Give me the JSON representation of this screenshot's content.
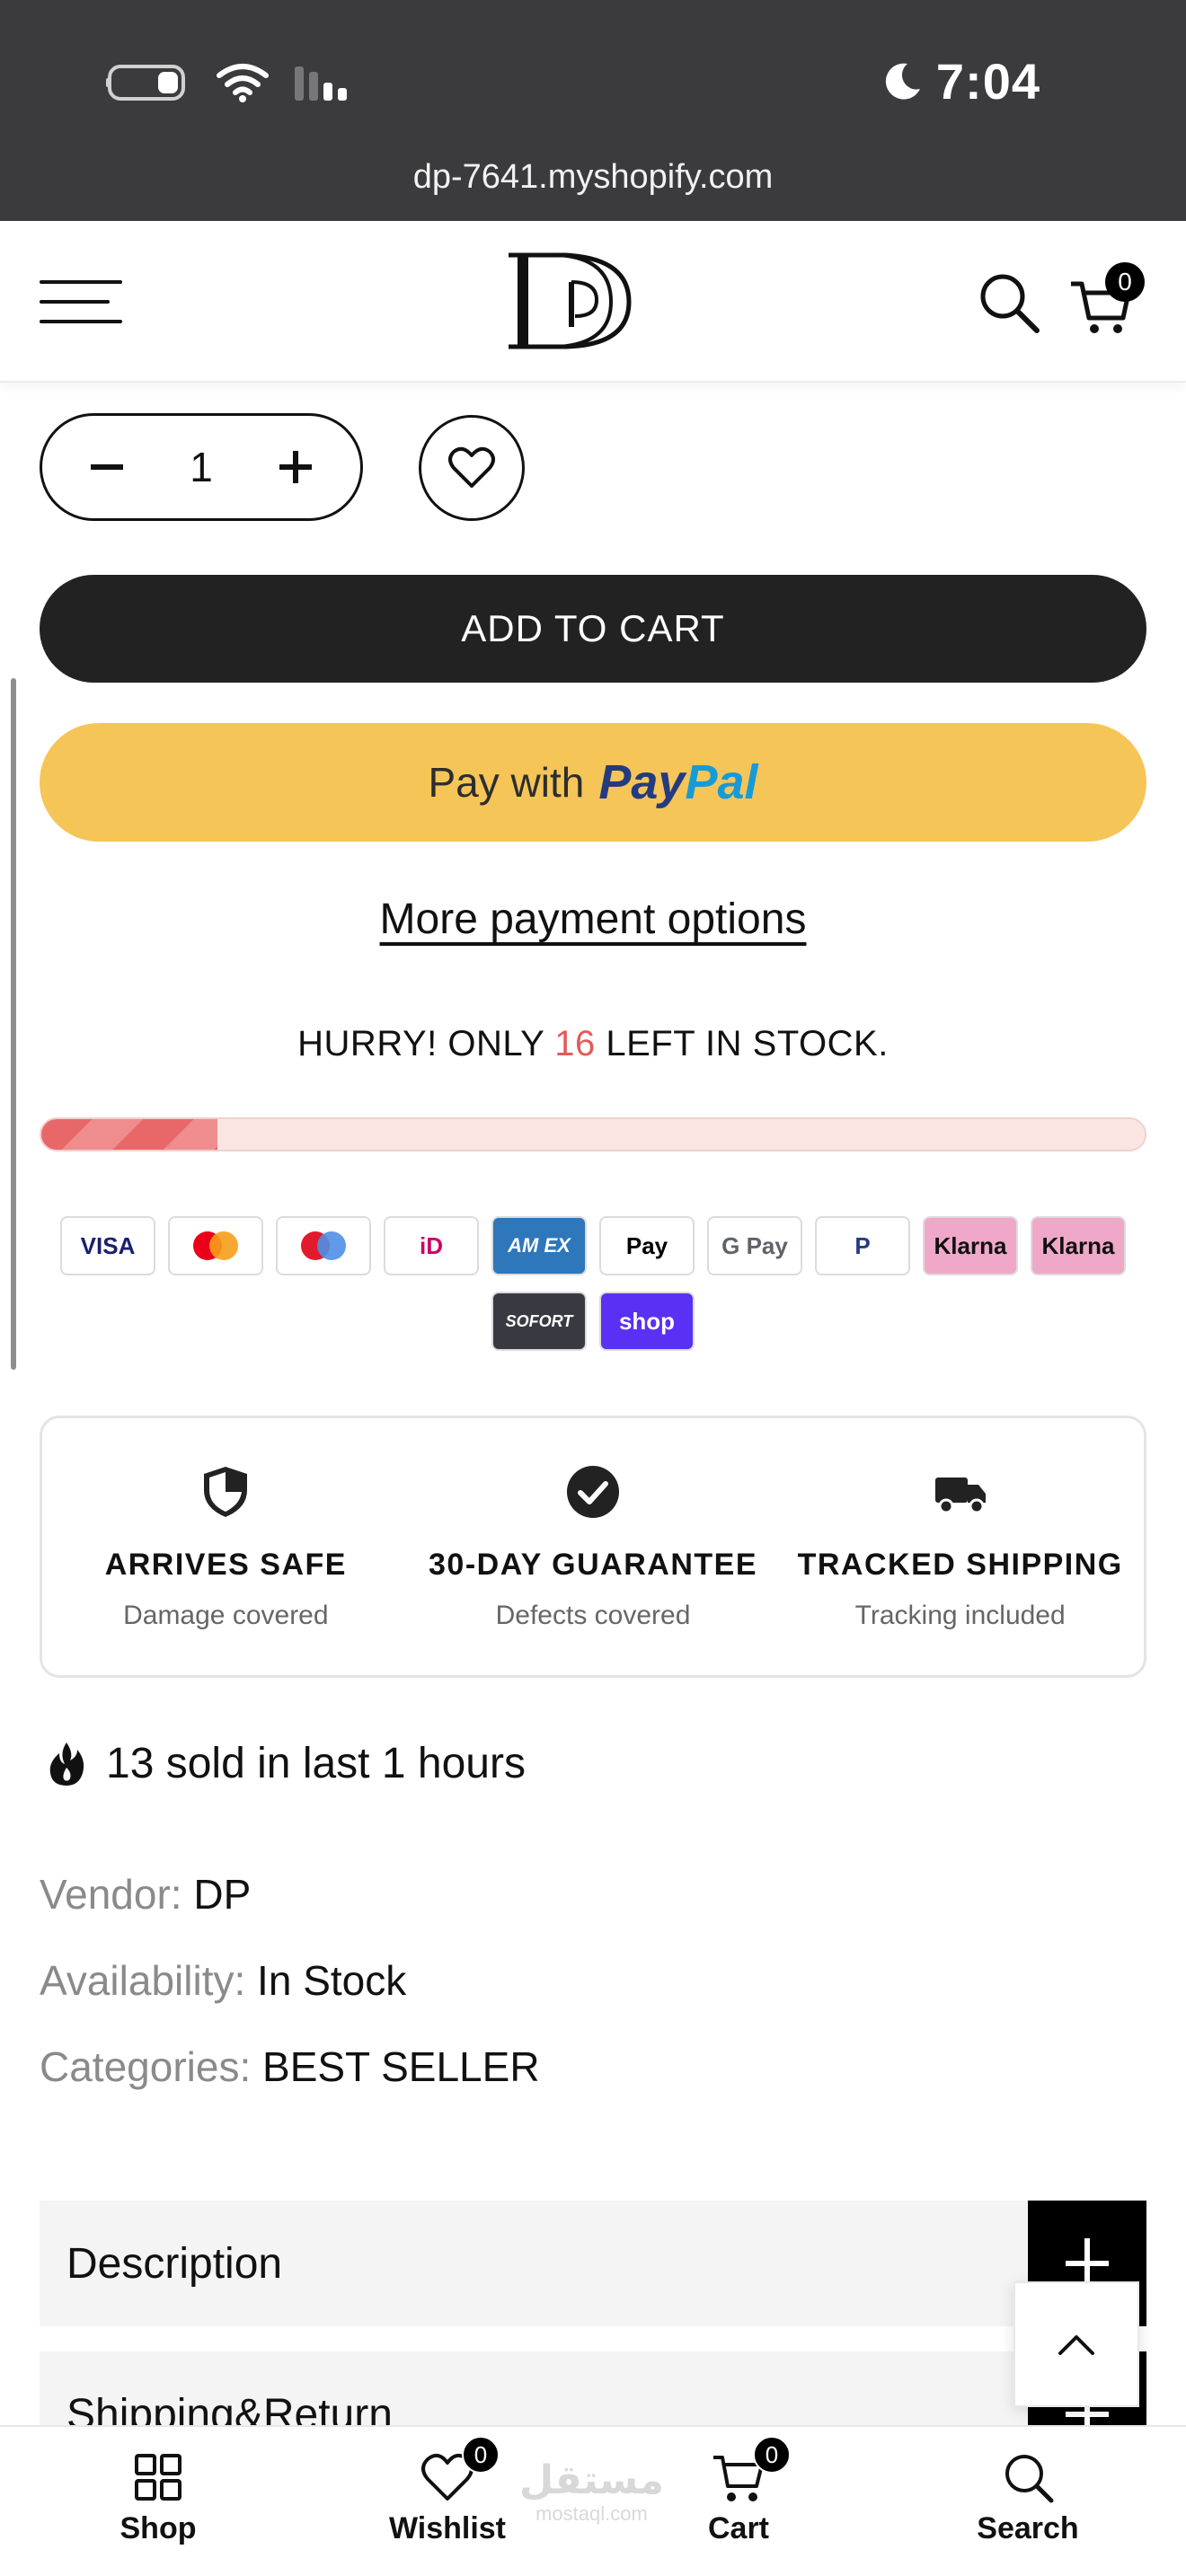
{
  "status_bar": {
    "time": "7:04"
  },
  "browser": {
    "url": "dp-7641.myshopify.com"
  },
  "header": {
    "cart_count": "0"
  },
  "product": {
    "quantity": "1",
    "add_to_cart_label": "ADD TO CART",
    "paypal_prefix": "Pay with",
    "paypal_brand_part1": "Pay",
    "paypal_brand_part2": "Pal",
    "more_payment_label": "More payment options",
    "stock": {
      "prefix": "HURRY! ONLY ",
      "count": "16",
      "suffix": " LEFT IN STOCK.",
      "level_percent": 16,
      "accent_color": "#e35a5a"
    }
  },
  "payment_icons": [
    {
      "label": "VISA",
      "color": "#1a1f71",
      "bg": "#ffffff"
    },
    {
      "label": "",
      "icon": "mastercard-icon",
      "bg": "#ffffff"
    },
    {
      "label": "",
      "icon": "maestro-icon",
      "bg": "#ffffff"
    },
    {
      "label": "iD",
      "icon": "ideal-icon",
      "color": "#cc0066",
      "bg": "#ffffff"
    },
    {
      "label": "AM EX",
      "color": "#ffffff",
      "bg": "#2e77bb"
    },
    {
      "label": " Pay",
      "icon": "apple-pay-icon",
      "color": "#000000",
      "bg": "#ffffff"
    },
    {
      "label": "G Pay",
      "color": "#5f6368",
      "bg": "#ffffff"
    },
    {
      "label": "P",
      "icon": "paypal-icon",
      "color": "#253b80",
      "bg": "#ffffff"
    },
    {
      "label": "Klarna",
      "color": "#111111",
      "bg": "#f0a8c8"
    },
    {
      "label": "Klarna",
      "color": "#111111",
      "bg": "#f0a8c8"
    },
    {
      "label": "SOFORT",
      "color": "#ffffff",
      "bg": "#393a41"
    },
    {
      "label": "shop",
      "color": "#ffffff",
      "bg": "#5a31f4"
    }
  ],
  "trust": [
    {
      "title": "ARRIVES SAFE",
      "subtitle": "Damage covered",
      "icon": "shield-icon"
    },
    {
      "title": "30-DAY GUARANTEE",
      "subtitle": "Defects covered",
      "icon": "check-circle-icon"
    },
    {
      "title": "TRACKED SHIPPING",
      "subtitle": "Tracking included",
      "icon": "truck-icon"
    }
  ],
  "sold_text": "13 sold in last 1 hours",
  "meta": {
    "vendor_label": "Vendor:",
    "vendor_value": "DP",
    "availability_label": "Availability:",
    "availability_value": "In Stock",
    "categories_label": "Categories:",
    "categories_value": "BEST SELLER"
  },
  "accordions": [
    {
      "label": "Description"
    },
    {
      "label": "Shipping&Return"
    }
  ],
  "bottom_nav": {
    "shop": "Shop",
    "wishlist": "Wishlist",
    "wishlist_count": "0",
    "cart": "Cart",
    "cart_count": "0",
    "search": "Search"
  },
  "watermark": {
    "main": "مستقل",
    "sub": "mostaql.com"
  }
}
